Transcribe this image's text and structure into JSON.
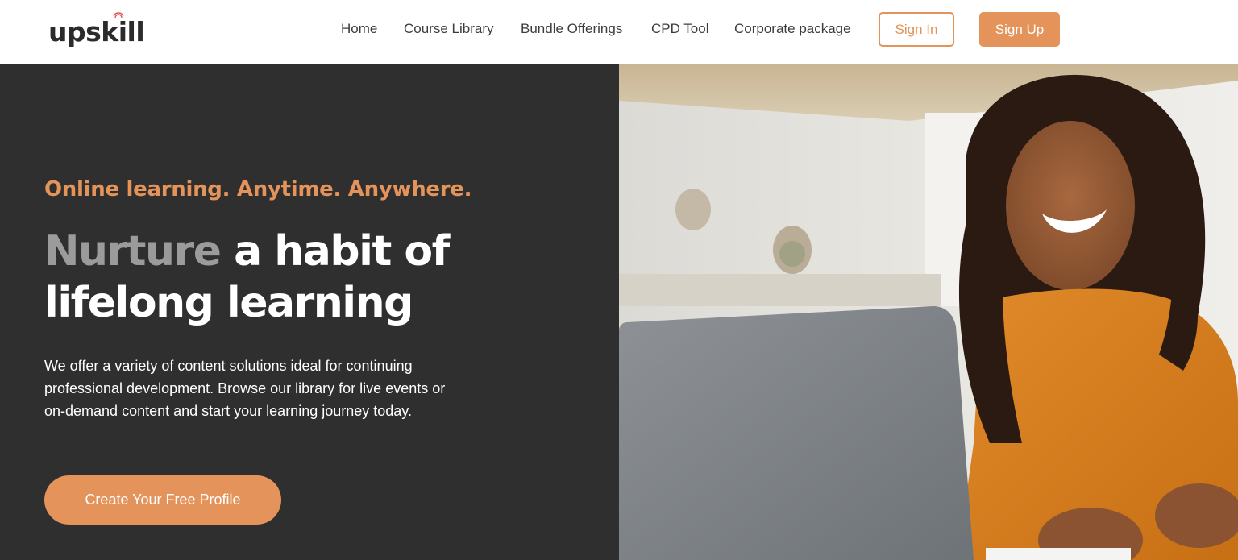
{
  "header": {
    "logo_text": "upskill",
    "nav": [
      {
        "label": "Home"
      },
      {
        "label": "Course Library"
      },
      {
        "label": "Bundle Offerings"
      },
      {
        "label": "CPD Tool"
      },
      {
        "label": "Corporate package"
      }
    ],
    "signin_label": "Sign In",
    "signup_label": "Sign Up"
  },
  "hero": {
    "tagline": "Online learning. Anytime. Anywhere.",
    "headline_accent": "Nurture",
    "headline_rest": " a habit of lifelong learning",
    "description": "We offer a variety of content solutions ideal for continuing professional development. Browse our library for live events or on-demand content and start your learning journey today.",
    "cta_label": "Create Your Free Profile"
  },
  "colors": {
    "accent": "#e4935a",
    "hero_bg": "#2f2f2f",
    "headline_muted": "#9b9b9b"
  },
  "icons": {
    "logo_mark": "signal-icon"
  }
}
